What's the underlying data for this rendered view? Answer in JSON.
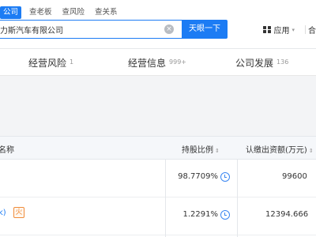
{
  "search": {
    "tabs": [
      "公司",
      "查老板",
      "查风险",
      "查关系"
    ],
    "query": "力斯汽车有限公司",
    "button_label": "天眼一下",
    "clear_glyph": "×"
  },
  "header": {
    "apps_label": "应用",
    "apps_caret": "▾",
    "cut_text": "合"
  },
  "categories": [
    {
      "label": "经营风险",
      "count": "1"
    },
    {
      "label": "经营信息",
      "count": "999+"
    },
    {
      "label": "公司发展",
      "count": "136"
    }
  ],
  "table": {
    "columns": [
      "名称",
      "持股比例",
      "认缴出资额(万元)"
    ],
    "sort_glyph": "⇕",
    "rows": [
      {
        "name": "",
        "ratio": "98.7709%",
        "capital": "99600"
      },
      {
        "name": "k)",
        "badge": "⽕",
        "ratio": "1.2291%",
        "capital": "12394.666"
      }
    ]
  },
  "colors": {
    "accent": "#1c7cf4",
    "badge": "#f08c3a"
  }
}
